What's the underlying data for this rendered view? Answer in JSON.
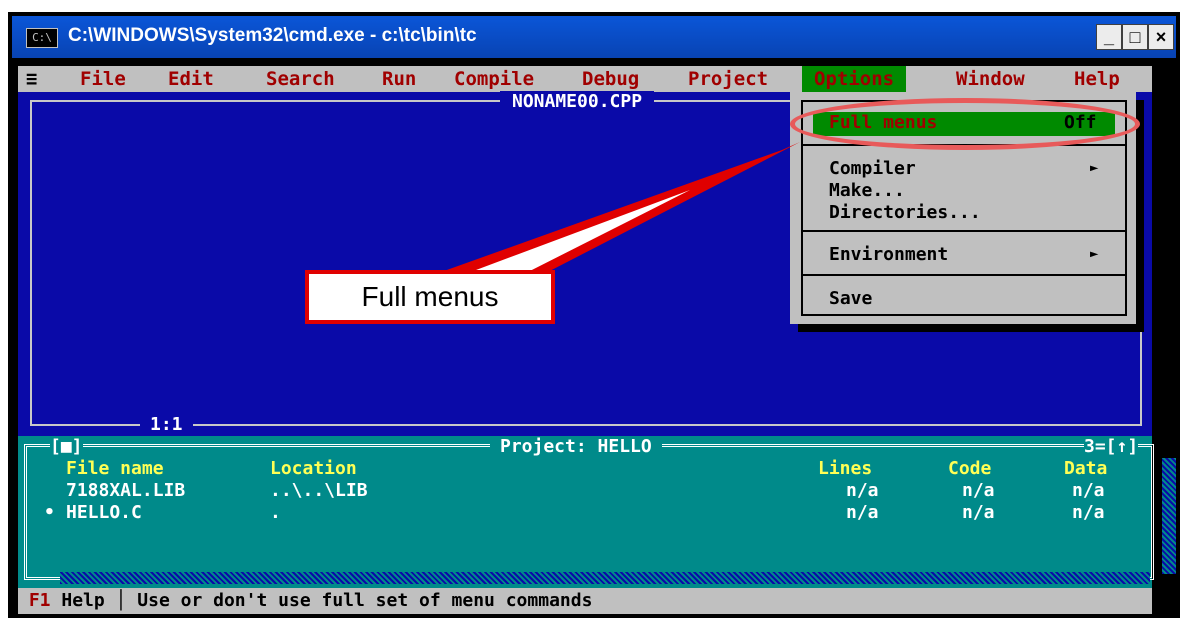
{
  "window": {
    "title": "C:\\WINDOWS\\System32\\cmd.exe - c:\\tc\\bin\\tc",
    "icon_label": "C:\\",
    "minimize_icon": "minimize-icon",
    "maximize_icon": "maximize-icon",
    "close_icon": "close-icon"
  },
  "menubar": {
    "system": "≡",
    "items": [
      "File",
      "Edit",
      "Search",
      "Run",
      "Compile",
      "Debug",
      "Project",
      "Options",
      "Window",
      "Help"
    ],
    "active": "Options"
  },
  "editor": {
    "filename": "NONAME00.CPP",
    "cursor": "1:1"
  },
  "options_menu": {
    "full_menus_label": "Full menus",
    "full_menus_value": "Off",
    "compiler": "Compiler",
    "make": "Make...",
    "directories": "Directories...",
    "environment": "Environment",
    "save": "Save",
    "submenu_arrow": "►"
  },
  "callout": {
    "text": "Full menus"
  },
  "project": {
    "title": "Project: HELLO",
    "left_marker": "[■]",
    "right_marker": "3=[↑]",
    "columns": [
      "File name",
      "Location",
      "Lines",
      "Code",
      "Data"
    ],
    "rows": [
      {
        "file": "7188XAL.LIB",
        "location": "..\\..\\LIB",
        "lines": "n/a",
        "code": "n/a",
        "data": "n/a"
      },
      {
        "file": "HELLO.C",
        "location": ".",
        "lines": "n/a",
        "code": "n/a",
        "data": "n/a",
        "bullet": "•"
      }
    ]
  },
  "statusbar": {
    "key": "F1",
    "key_label": "Help",
    "separator": "│",
    "message": "Use or don't use full set of menu commands"
  },
  "colors": {
    "editor_bg": "#0a0aa8",
    "menu_bg": "#c0c0c0",
    "highlight": "#008a00",
    "project_bg": "#008a8a",
    "callout_border": "#e00000"
  }
}
